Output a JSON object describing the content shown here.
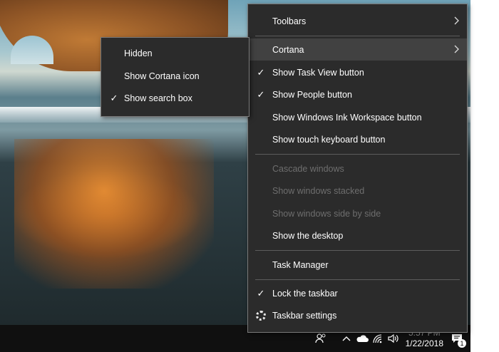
{
  "main_menu": {
    "toolbars": "Toolbars",
    "cortana": "Cortana",
    "show_task_view": "Show Task View button",
    "show_people": "Show People button",
    "show_ink_workspace": "Show Windows Ink Workspace button",
    "show_touch_keyboard": "Show touch keyboard button",
    "cascade_windows": "Cascade windows",
    "show_stacked": "Show windows stacked",
    "show_side_by_side": "Show windows side by side",
    "show_desktop": "Show the desktop",
    "task_manager": "Task Manager",
    "lock_taskbar": "Lock the taskbar",
    "taskbar_settings": "Taskbar settings"
  },
  "cortana_submenu": {
    "hidden": "Hidden",
    "show_cortana_icon": "Show Cortana icon",
    "show_search_box": "Show search box"
  },
  "checkmark": "✓",
  "arrow": "›",
  "tray": {
    "date": "1/22/2018",
    "time": "5:57 PM",
    "notification_count": "1"
  }
}
